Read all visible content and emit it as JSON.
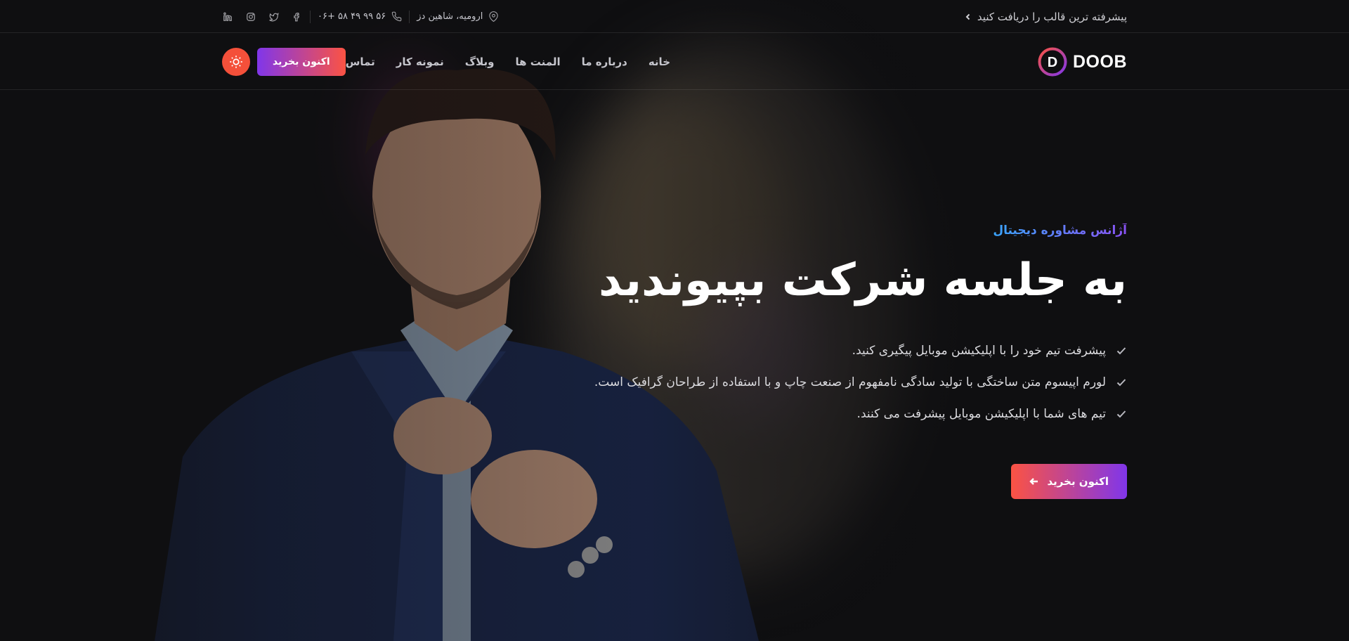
{
  "topbar": {
    "promo_link": "پیشرفته ترین قالب را دریافت کنید",
    "address": "ارومیه، شاهین دز",
    "phone": "۰۶+ ۵۸ ۴۹ ۹۹ ۵۶",
    "social": [
      "facebook-icon",
      "twitter-icon",
      "instagram-icon",
      "linkedin-icon"
    ]
  },
  "header": {
    "logo_text": "DOOB",
    "nav": [
      "خانه",
      "درباره ما",
      "المنت ها",
      "وبلاگ",
      "نمونه کار",
      "تماس"
    ],
    "buy_button": "اکنون بخرید",
    "theme_toggle": "sun-icon"
  },
  "hero": {
    "eyebrow": "آژانس مشاوره دیجیتال",
    "headline": "به جلسه شرکت بپیوندید",
    "features": [
      "پیشرفت تیم خود را با اپلیکیشن موبایل پیگیری کنید.",
      "لورم اپیسوم متن ساختگی با تولید سادگی نامفهوم از صنعت چاپ و با استفاده از طراحان گرافیک است.",
      "تیم های شما با اپلیکیشن موبایل پیشرفت می کنند."
    ],
    "cta_label": "اکنون بخرید"
  },
  "colors": {
    "accent_gradient_start": "#8036ea",
    "accent_gradient_end": "#fb5343",
    "eyebrow_start": "#3aa6ff",
    "eyebrow_end": "#8a52f4",
    "theme_toggle_bg": "#f4503a",
    "background": "#0f0f11"
  }
}
